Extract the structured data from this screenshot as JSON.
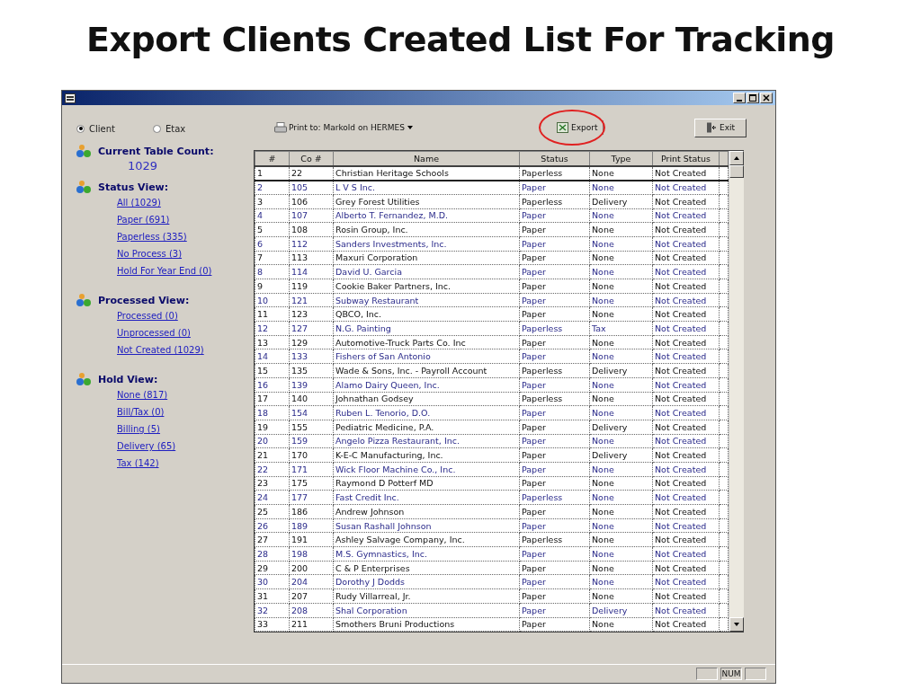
{
  "slide_title": "Export Clients Created List For Tracking",
  "radios": [
    {
      "label": "Client",
      "selected": true
    },
    {
      "label": "Etax",
      "selected": false
    }
  ],
  "printer": {
    "label": "Print to: Markold on HERMES"
  },
  "export_button": {
    "label": "Export",
    "highlighted": true
  },
  "exit_button": {
    "label": "Exit"
  },
  "table_count": {
    "heading": "Current Table Count:",
    "value": "1029"
  },
  "views": [
    {
      "heading": "Status View:",
      "links": [
        "All (1029)",
        "Paper (691)",
        "Paperless (335)",
        "No Process (3)",
        "Hold For Year End (0)"
      ]
    },
    {
      "heading": "Processed View:",
      "links": [
        "Processed (0)",
        "Unprocessed (0)",
        "Not Created (1029)"
      ]
    },
    {
      "heading": "Hold View:",
      "links": [
        "None (817)",
        "Bill/Tax (0)",
        "Billing (5)",
        "Delivery (65)",
        "Tax (142)"
      ]
    }
  ],
  "table": {
    "columns": [
      "#",
      "Co #",
      "Name",
      "Status",
      "Type",
      "Print Status"
    ],
    "rows": [
      {
        "cells": [
          "1",
          "22",
          "Christian Heritage Schools",
          "Paperless",
          "None",
          "Not Created"
        ],
        "selected": true
      },
      {
        "cells": [
          "2",
          "105",
          "L V S Inc.",
          "Paper",
          "None",
          "Not Created"
        ],
        "selected": false
      },
      {
        "cells": [
          "3",
          "106",
          "Grey Forest Utilities",
          "Paperless",
          "Delivery",
          "Not Created"
        ],
        "selected": false
      },
      {
        "cells": [
          "4",
          "107",
          "Alberto T. Fernandez, M.D.",
          "Paper",
          "None",
          "Not Created"
        ],
        "selected": false
      },
      {
        "cells": [
          "5",
          "108",
          "Rosin Group, Inc.",
          "Paper",
          "None",
          "Not Created"
        ],
        "selected": false
      },
      {
        "cells": [
          "6",
          "112",
          "Sanders Investments, Inc.",
          "Paper",
          "None",
          "Not Created"
        ],
        "selected": false
      },
      {
        "cells": [
          "7",
          "113",
          "Maxuri Corporation",
          "Paper",
          "None",
          "Not Created"
        ],
        "selected": false
      },
      {
        "cells": [
          "8",
          "114",
          "David U. Garcia",
          "Paper",
          "None",
          "Not Created"
        ],
        "selected": false
      },
      {
        "cells": [
          "9",
          "119",
          "Cookie Baker Partners, Inc.",
          "Paper",
          "None",
          "Not Created"
        ],
        "selected": false
      },
      {
        "cells": [
          "10",
          "121",
          "Subway Restaurant",
          "Paper",
          "None",
          "Not Created"
        ],
        "selected": false
      },
      {
        "cells": [
          "11",
          "123",
          "QBCO, Inc.",
          "Paper",
          "None",
          "Not Created"
        ],
        "selected": false
      },
      {
        "cells": [
          "12",
          "127",
          "N.G. Painting",
          "Paperless",
          "Tax",
          "Not Created"
        ],
        "selected": false
      },
      {
        "cells": [
          "13",
          "129",
          "Automotive-Truck Parts Co. Inc",
          "Paper",
          "None",
          "Not Created"
        ],
        "selected": false
      },
      {
        "cells": [
          "14",
          "133",
          "Fishers of San Antonio",
          "Paper",
          "None",
          "Not Created"
        ],
        "selected": false
      },
      {
        "cells": [
          "15",
          "135",
          "Wade & Sons, Inc. - Payroll Account",
          "Paperless",
          "Delivery",
          "Not Created"
        ],
        "selected": false
      },
      {
        "cells": [
          "16",
          "139",
          "Alamo Dairy Queen, Inc.",
          "Paper",
          "None",
          "Not Created"
        ],
        "selected": false
      },
      {
        "cells": [
          "17",
          "140",
          "Johnathan Godsey",
          "Paperless",
          "None",
          "Not Created"
        ],
        "selected": false
      },
      {
        "cells": [
          "18",
          "154",
          "Ruben L. Tenorio, D.O.",
          "Paper",
          "None",
          "Not Created"
        ],
        "selected": false
      },
      {
        "cells": [
          "19",
          "155",
          "Pediatric Medicine, P.A.",
          "Paper",
          "Delivery",
          "Not Created"
        ],
        "selected": false
      },
      {
        "cells": [
          "20",
          "159",
          "Angelo Pizza Restaurant, Inc.",
          "Paper",
          "None",
          "Not Created"
        ],
        "selected": false
      },
      {
        "cells": [
          "21",
          "170",
          "K-E-C Manufacturing, Inc.",
          "Paper",
          "Delivery",
          "Not Created"
        ],
        "selected": false
      },
      {
        "cells": [
          "22",
          "171",
          "Wick Floor Machine Co., Inc.",
          "Paper",
          "None",
          "Not Created"
        ],
        "selected": false
      },
      {
        "cells": [
          "23",
          "175",
          "Raymond D Potterf MD",
          "Paper",
          "None",
          "Not Created"
        ],
        "selected": false
      },
      {
        "cells": [
          "24",
          "177",
          "Fast Credit Inc.",
          "Paperless",
          "None",
          "Not Created"
        ],
        "selected": false
      },
      {
        "cells": [
          "25",
          "186",
          "Andrew Johnson",
          "Paper",
          "None",
          "Not Created"
        ],
        "selected": false
      },
      {
        "cells": [
          "26",
          "189",
          "Susan Rashall Johnson",
          "Paper",
          "None",
          "Not Created"
        ],
        "selected": false
      },
      {
        "cells": [
          "27",
          "191",
          "Ashley Salvage Company, Inc.",
          "Paperless",
          "None",
          "Not Created"
        ],
        "selected": false
      },
      {
        "cells": [
          "28",
          "198",
          "M.S. Gymnastics, Inc.",
          "Paper",
          "None",
          "Not Created"
        ],
        "selected": false
      },
      {
        "cells": [
          "29",
          "200",
          "C & P Enterprises",
          "Paper",
          "None",
          "Not Created"
        ],
        "selected": false
      },
      {
        "cells": [
          "30",
          "204",
          "Dorothy J Dodds",
          "Paper",
          "None",
          "Not Created"
        ],
        "selected": false
      },
      {
        "cells": [
          "31",
          "207",
          "Rudy Villarreal, Jr.",
          "Paper",
          "None",
          "Not Created"
        ],
        "selected": false
      },
      {
        "cells": [
          "32",
          "208",
          "Shal Corporation",
          "Paper",
          "Delivery",
          "Not Created"
        ],
        "selected": false
      },
      {
        "cells": [
          "33",
          "211",
          "Smothers Bruni Productions",
          "Paper",
          "None",
          "Not Created"
        ],
        "selected": false
      }
    ]
  },
  "status_bar": {
    "indicator": "NUM"
  }
}
